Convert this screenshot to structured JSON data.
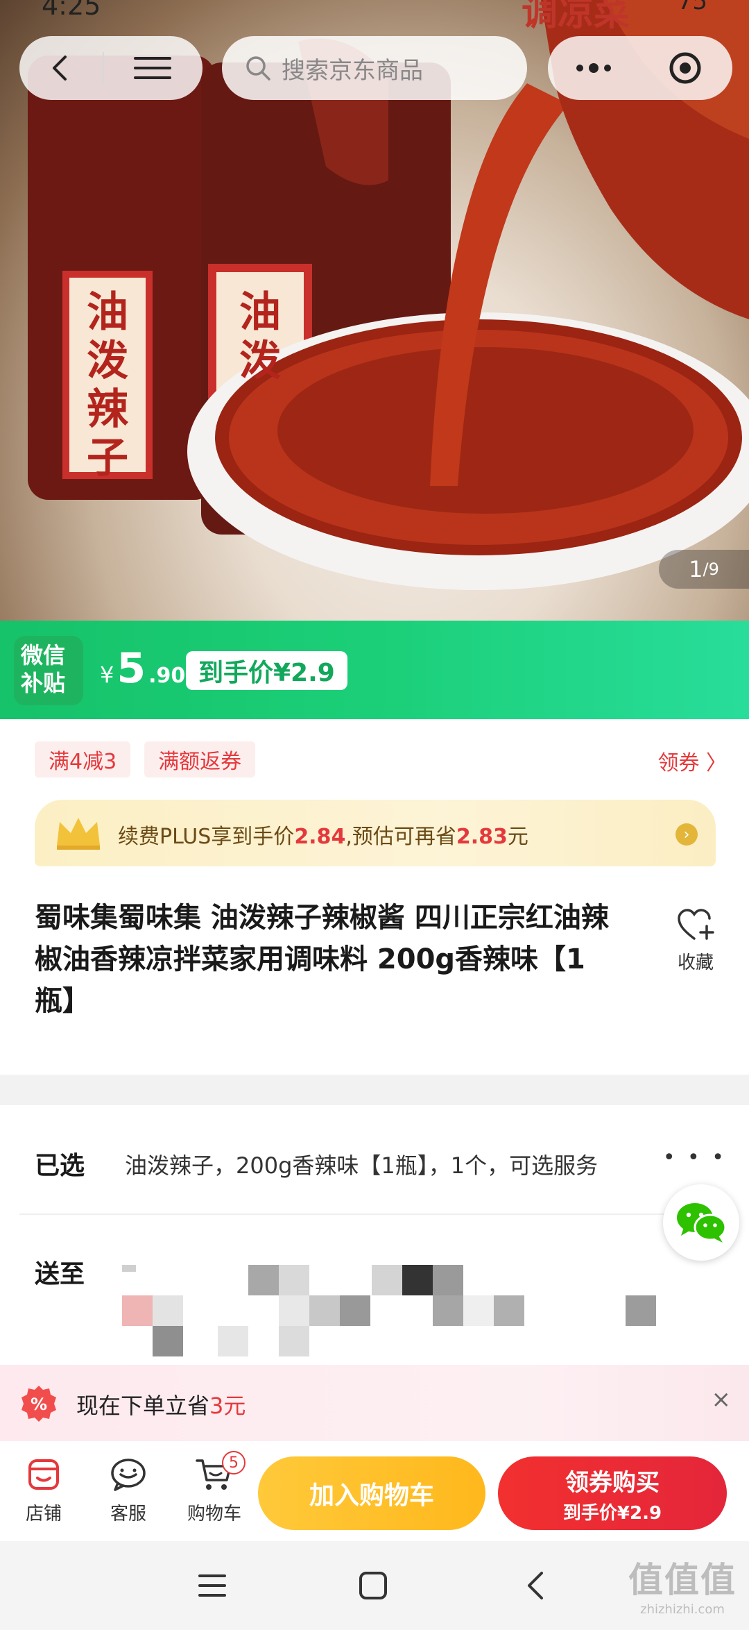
{
  "status_bar": {
    "time": "4:25",
    "right": "75"
  },
  "top_nav": {
    "search_placeholder": "搜索京东商品"
  },
  "hero": {
    "image_counter_current": "1",
    "image_counter_total": "/9",
    "banner_text": "调凉菜",
    "bottle_label": "油泼辣子"
  },
  "price_bar": {
    "badge_line1": "微信",
    "badge_line2": "补贴",
    "currency": "¥",
    "price_int": "5",
    "price_dec": ".90",
    "final_price_label": "到手价¥2.9"
  },
  "coupons": {
    "tags": [
      "满4减3",
      "满额返券"
    ],
    "get_coupon": "领券 〉"
  },
  "plus_banner": {
    "prefix": "续费PLUS享到手价",
    "plus_price": "2.84",
    "middle": ",预估可再省",
    "save_amount": "2.83",
    "suffix": "元"
  },
  "product": {
    "title": "蜀味集蜀味集 油泼辣子辣椒酱 四川正宗红油辣椒油香辣凉拌菜家用调味料 200g香辣味【1瓶】",
    "favorite_label": "收藏"
  },
  "spec": {
    "selected_label": "已选",
    "selected_value": "油泼辣子，200g香辣味【1瓶】，1个，可选服务",
    "ship_label": "送至",
    "more_dots": "• • •"
  },
  "save_banner": {
    "prefix": "现在下单立省",
    "amount": "3元",
    "close": "×"
  },
  "action_bar": {
    "shop_label": "店铺",
    "service_label": "客服",
    "cart_label": "购物车",
    "cart_count": "5",
    "add_to_cart": "加入购物车",
    "buy_main": "领券购买",
    "buy_sub": "到手价¥2.9"
  },
  "watermark": {
    "big": "值值值",
    "small": "zhizhizhi.com"
  },
  "colors": {
    "jd_red": "#e4393c",
    "wechat_green": "#1bcf78",
    "cart_yellow": "#ffb81c"
  },
  "icons": [
    "back-icon",
    "menu-icon",
    "search-icon",
    "more-icon",
    "target-icon",
    "crown-icon",
    "heart-plus-icon",
    "wechat-icon",
    "percent-icon",
    "close-icon",
    "shop-icon",
    "service-icon",
    "cart-icon",
    "sys-menu-icon",
    "sys-home-icon",
    "sys-back-icon"
  ]
}
